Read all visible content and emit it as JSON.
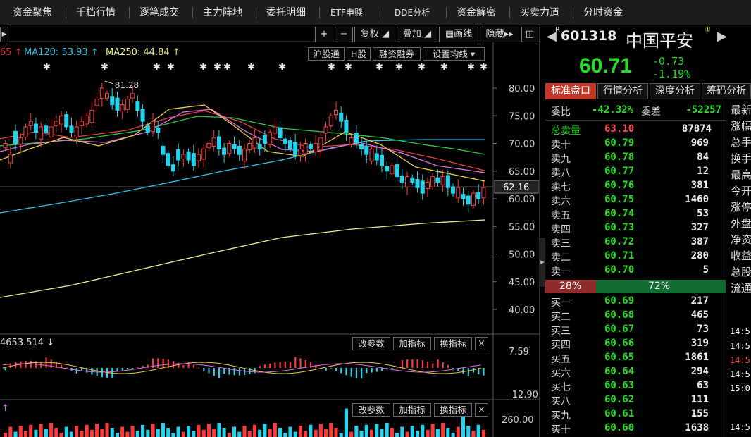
{
  "nav": [
    "资金聚焦",
    "千档行情",
    "逐笔成交",
    "主力阵地",
    "委托明细",
    "ETF申赎",
    "DDE分析",
    "资金解密",
    "买卖力道",
    "分时资金"
  ],
  "toolbar": {
    "plus": "+",
    "minus": "−",
    "fuquan": "复权",
    "diejia": "叠加",
    "huaxian": "画线",
    "yincang": "隐藏"
  },
  "ma": {
    "ma_left": "65 ↑",
    "ma120": "MA120: 53.93 ↑",
    "ma250": "MA250: 44.84 ↑"
  },
  "chart_buttons": {
    "hgt": "沪股通",
    "hshare": "H股",
    "rzrq": "融资融券",
    "setma": "设置均线"
  },
  "indicator_buttons": {
    "params": "改参数",
    "add": "加指标",
    "switch": "换指标",
    "close": "×"
  },
  "macd_label": "4653.514 ↓",
  "vol_label": "↑",
  "chart_data": {
    "type": "candlestick",
    "yaxis_ticks": [
      "80.00",
      "75.00",
      "70.00",
      "65.00",
      "60.00",
      "55.00",
      "50.00",
      "45.00",
      "40.00"
    ],
    "ylim": [
      38,
      84
    ],
    "last_price_tag": "62.16",
    "last_price": 62.16,
    "high_annotation": "81.28",
    "high_value": 81.28,
    "ma_left_value": 65,
    "ma120_value": 53.93,
    "ma250_value": 44.84,
    "macd_ticks": [
      "7.59",
      "-12.90"
    ],
    "volume_ticks": [
      "260.00"
    ]
  },
  "stock": {
    "code": "601318",
    "name": "中国平安",
    "price": "60.71",
    "change": "-0.73",
    "pct": "-1.19%",
    "tabs": [
      "标准盘口",
      "行情分析",
      "深度分析",
      "筹码分析"
    ]
  },
  "weibi": {
    "label": "委比",
    "value": "-42.32%",
    "diff_label": "委差",
    "diff_value": "-52257"
  },
  "total_sell": {
    "label": "总卖量",
    "price": "63.10",
    "volume": "87874"
  },
  "sells": [
    {
      "label": "卖十",
      "price": "60.79",
      "volume": "969"
    },
    {
      "label": "卖九",
      "price": "60.78",
      "volume": "84"
    },
    {
      "label": "卖八",
      "price": "60.77",
      "volume": "12"
    },
    {
      "label": "卖七",
      "price": "60.76",
      "volume": "381"
    },
    {
      "label": "卖六",
      "price": "60.75",
      "volume": "1460"
    },
    {
      "label": "卖五",
      "price": "60.74",
      "volume": "53"
    },
    {
      "label": "卖四",
      "price": "60.73",
      "volume": "327"
    },
    {
      "label": "卖三",
      "price": "60.72",
      "volume": "387"
    },
    {
      "label": "卖二",
      "price": "60.71",
      "volume": "280"
    },
    {
      "label": "卖一",
      "price": "60.70",
      "volume": "5"
    }
  ],
  "ratio": {
    "left": "28%",
    "right": "72%",
    "left_fraction": 0.28
  },
  "buys": [
    {
      "label": "买一",
      "price": "60.69",
      "volume": "217"
    },
    {
      "label": "买二",
      "price": "60.68",
      "volume": "465"
    },
    {
      "label": "买三",
      "price": "60.67",
      "volume": "73"
    },
    {
      "label": "买四",
      "price": "60.66",
      "volume": "319"
    },
    {
      "label": "买五",
      "price": "60.65",
      "volume": "1861"
    },
    {
      "label": "买六",
      "price": "60.64",
      "volume": "294"
    },
    {
      "label": "买七",
      "price": "60.63",
      "volume": "63"
    },
    {
      "label": "买八",
      "price": "60.62",
      "volume": "111"
    },
    {
      "label": "买九",
      "price": "60.61",
      "volume": "155"
    },
    {
      "label": "买十",
      "price": "60.60",
      "volume": "1638"
    }
  ],
  "side_labels": [
    "最新",
    "涨幅",
    "总手",
    "换手",
    "最高",
    "今开",
    "涨停",
    "外盘",
    "净资",
    "收益",
    "总股",
    "流通"
  ],
  "times": [
    "14:5",
    "14:5",
    "14:5",
    "14:5",
    "15:0",
    "14:5"
  ]
}
